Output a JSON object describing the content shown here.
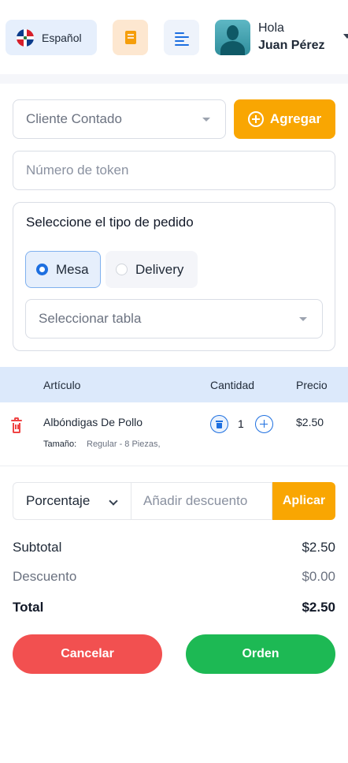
{
  "header": {
    "language_label": "Español",
    "flag_icon": "dominican-republic-flag-icon",
    "receipt_icon": "receipt-icon",
    "menu_icon": "menu-lines-icon",
    "greeting": "Hola",
    "user_name": "Juan Pérez"
  },
  "form": {
    "customer_select": "Cliente Contado",
    "add_button": "Agregar",
    "token_placeholder": "Número de token",
    "order_type_title": "Seleccione el tipo de pedido",
    "order_types": [
      {
        "label": "Mesa",
        "selected": true
      },
      {
        "label": "Delivery",
        "selected": false
      }
    ],
    "table_select_placeholder": "Seleccionar tabla"
  },
  "items_table": {
    "headers": {
      "item": "Artículo",
      "quantity": "Cantidad",
      "price": "Precio"
    },
    "rows": [
      {
        "name": "Albóndigas De Pollo",
        "size_label": "Tamaño:",
        "size_value": "Regular - 8 Piezas,",
        "quantity": "1",
        "price": "$2.50"
      }
    ]
  },
  "discount": {
    "type": "Porcentaje",
    "placeholder": "Añadir descuento",
    "apply_button": "Aplicar"
  },
  "totals": {
    "subtotal_label": "Subtotal",
    "subtotal_value": "$2.50",
    "discount_label": "Descuento",
    "discount_value": "$0.00",
    "total_label": "Total",
    "total_value": "$2.50"
  },
  "actions": {
    "cancel": "Cancelar",
    "order": "Orden"
  },
  "colors": {
    "accent_orange": "#f9a602",
    "primary_blue": "#1d6fe0",
    "danger_red": "#f25050",
    "success_green": "#1db954"
  }
}
